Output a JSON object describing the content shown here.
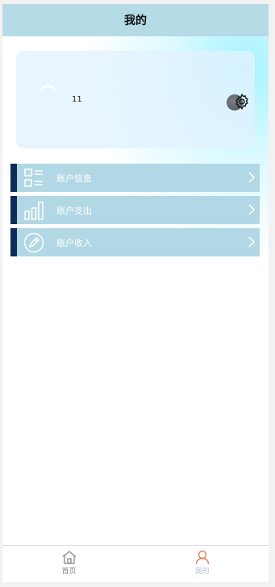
{
  "navbar": {
    "title": "我的"
  },
  "profile": {
    "username": "11"
  },
  "menu": {
    "items": [
      {
        "label": "账户信息",
        "icon": "list-icon"
      },
      {
        "label": "账户支出",
        "icon": "bar-chart-icon"
      },
      {
        "label": "账户收入",
        "icon": "pencil-icon"
      }
    ]
  },
  "tabbar": {
    "home_label": "首页",
    "mine_label": "我的"
  },
  "colors": {
    "navbar_bg": "#b5dbe6",
    "menu_bg": "#b2d8e5",
    "menu_accent": "#0b2d57",
    "active_tab_icon": "#e08060"
  }
}
